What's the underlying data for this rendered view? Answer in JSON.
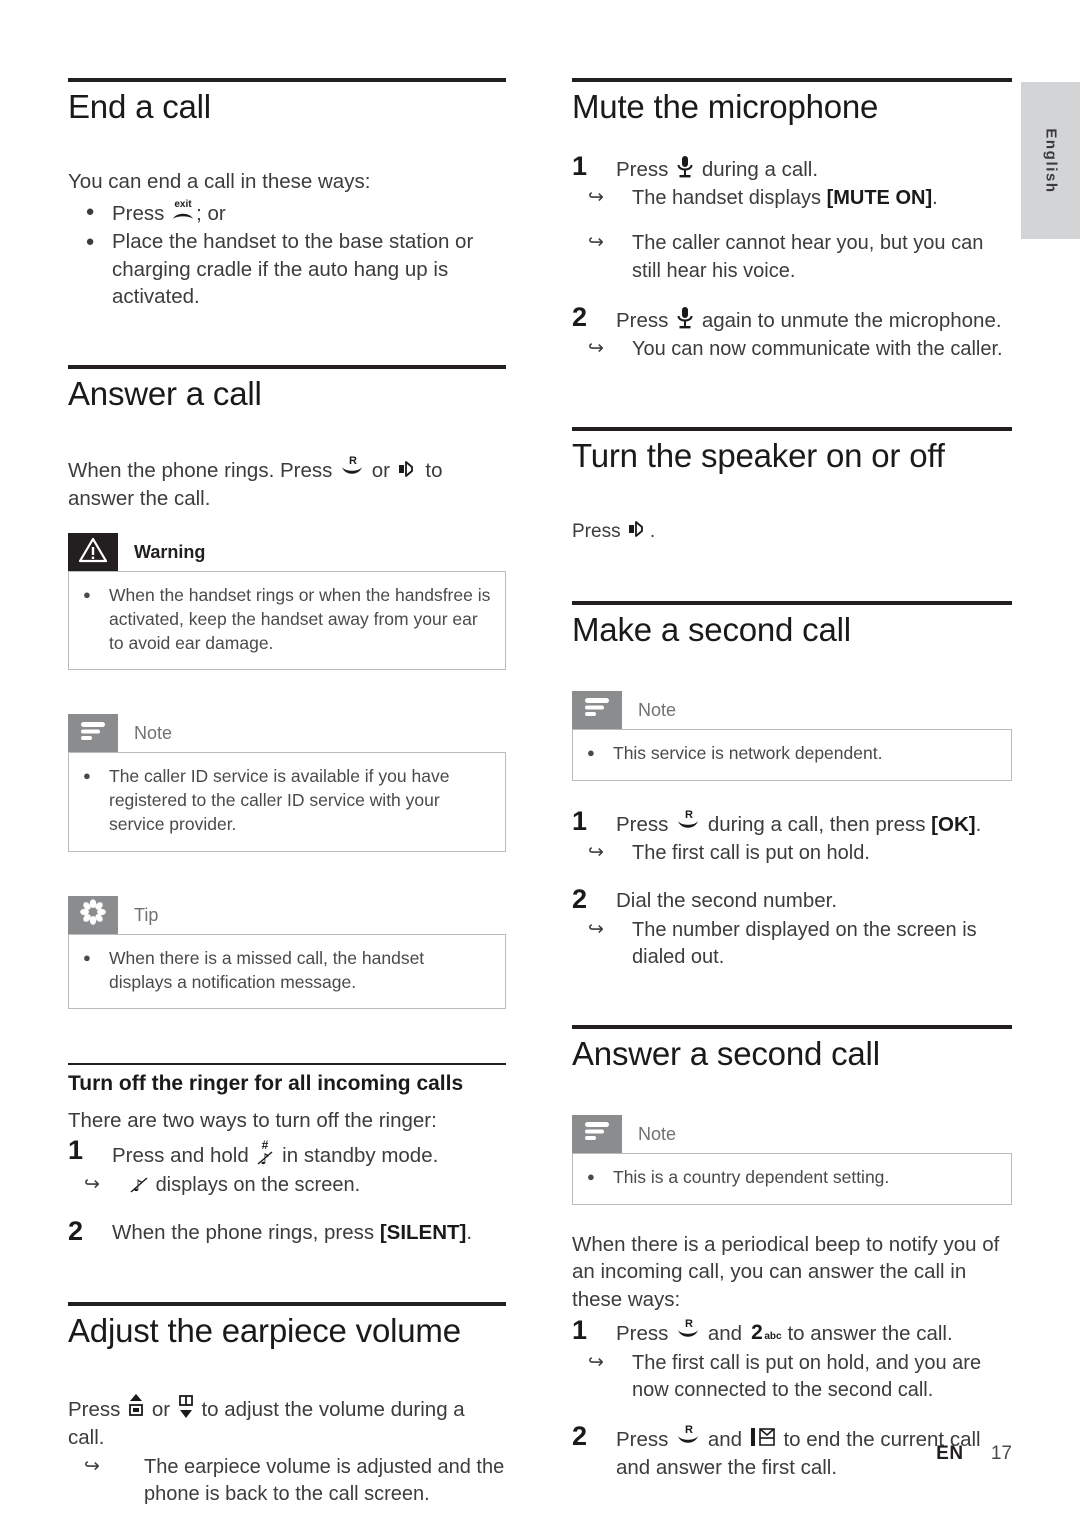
{
  "page": {
    "language_tab": "English",
    "footer": {
      "lang_code": "EN",
      "page_number": "17"
    }
  },
  "left_column": {
    "sections": [
      {
        "id": "end-a-call",
        "title": "End a call",
        "intro": "You can end a call in these ways:",
        "bullets": [
          "Press  ; or",
          "Place the handset to the base station or charging cradle if the auto hang up is activated."
        ]
      },
      {
        "id": "answer-a-call",
        "title": "Answer a call",
        "intro_before": "When the phone rings. Press",
        "intro_mid": "or",
        "intro_after": "to answer the call.",
        "warning": {
          "label": "Warning",
          "items": [
            "When the handset rings or when the handsfree is activated, keep the handset away from your ear to avoid ear damage."
          ]
        },
        "note": {
          "label": "Note",
          "items": [
            "The caller ID service is available if you have registered to the caller ID service with your service provider."
          ]
        },
        "tip": {
          "label": "Tip",
          "items": [
            "When there is a missed call, the handset displays a notification message."
          ]
        },
        "subsection": {
          "title": "Turn off the ringer for all incoming calls",
          "intro": "There are two ways to turn off the ringer:",
          "steps": [
            {
              "num": "1",
              "text_before": "Press and hold",
              "text_after": "in standby mode.",
              "results": [
                "displays on the screen."
              ]
            },
            {
              "num": "2",
              "text_before": "When the phone rings, press",
              "bracket": "[SILENT]",
              "text_after": ".",
              "results": []
            }
          ]
        }
      },
      {
        "id": "adjust-the-earpiece-volume",
        "title": "Adjust the earpiece volume",
        "intro_before": "Press",
        "intro_mid": "or",
        "intro_after": "to adjust the volume during a call.",
        "results": [
          "The earpiece volume is adjusted and the phone is back to the call screen."
        ]
      }
    ]
  },
  "right_column": {
    "sections": [
      {
        "id": "mute-the-microphone",
        "title": "Mute the microphone",
        "steps": [
          {
            "num": "1",
            "text_before": "Press",
            "text_after": "during a call.",
            "results": [
              {
                "text_before": "The handset displays",
                "bracket": "[MUTE ON]",
                "text_after": "."
              },
              {
                "text_before": "The caller cannot hear you, but you can still hear his voice.",
                "bracket": "",
                "text_after": ""
              }
            ]
          },
          {
            "num": "2",
            "text_before": "Press",
            "text_after": "again to unmute the microphone.",
            "results": [
              {
                "text_before": "You can now communicate with the caller.",
                "bracket": "",
                "text_after": ""
              }
            ]
          }
        ]
      },
      {
        "id": "turn-the-speaker-on-or-off",
        "title": "Turn the speaker on or off",
        "intro_before": "Press",
        "intro_after": "."
      },
      {
        "id": "make-a-second-call",
        "title": "Make a second call",
        "note": {
          "label": "Note",
          "items": [
            "This service is network dependent."
          ]
        },
        "steps": [
          {
            "num": "1",
            "text_before": "Press",
            "text_mid": "during a call, then press",
            "bracket": "[OK]",
            "text_after": ".",
            "results": [
              "The first call is put on hold."
            ]
          },
          {
            "num": "2",
            "text_plain": "Dial the second number.",
            "results": [
              "The number displayed on the screen is dialed out."
            ]
          }
        ]
      },
      {
        "id": "answer-a-second-call",
        "title": "Answer a second call",
        "note": {
          "label": "Note",
          "items": [
            "This is a country dependent setting."
          ]
        },
        "intro": "When there is a periodical beep to notify you of an incoming call, you can answer the call in these ways:",
        "steps": [
          {
            "num": "1",
            "text_before": "Press",
            "text_mid": "and",
            "text_after": "to answer the call.",
            "results": [
              "The first call is put on hold, and you are now connected to the second call."
            ]
          },
          {
            "num": "2",
            "text_before": "Press",
            "text_mid": "and",
            "text_after": "to end the current call and answer the first call.",
            "results": []
          }
        ]
      }
    ]
  },
  "icons": {
    "hangup_label": "exit",
    "talk_label": "R",
    "key2_label": "abc",
    "key2_digit": "2",
    "hash_label": "#"
  },
  "colors": {
    "rule": "#231f20",
    "badge_gray": "#8a8c8e",
    "badge_dark": "#231f20",
    "tab_gray": "#d2d4d6",
    "body_text": "#3c3c3c"
  }
}
